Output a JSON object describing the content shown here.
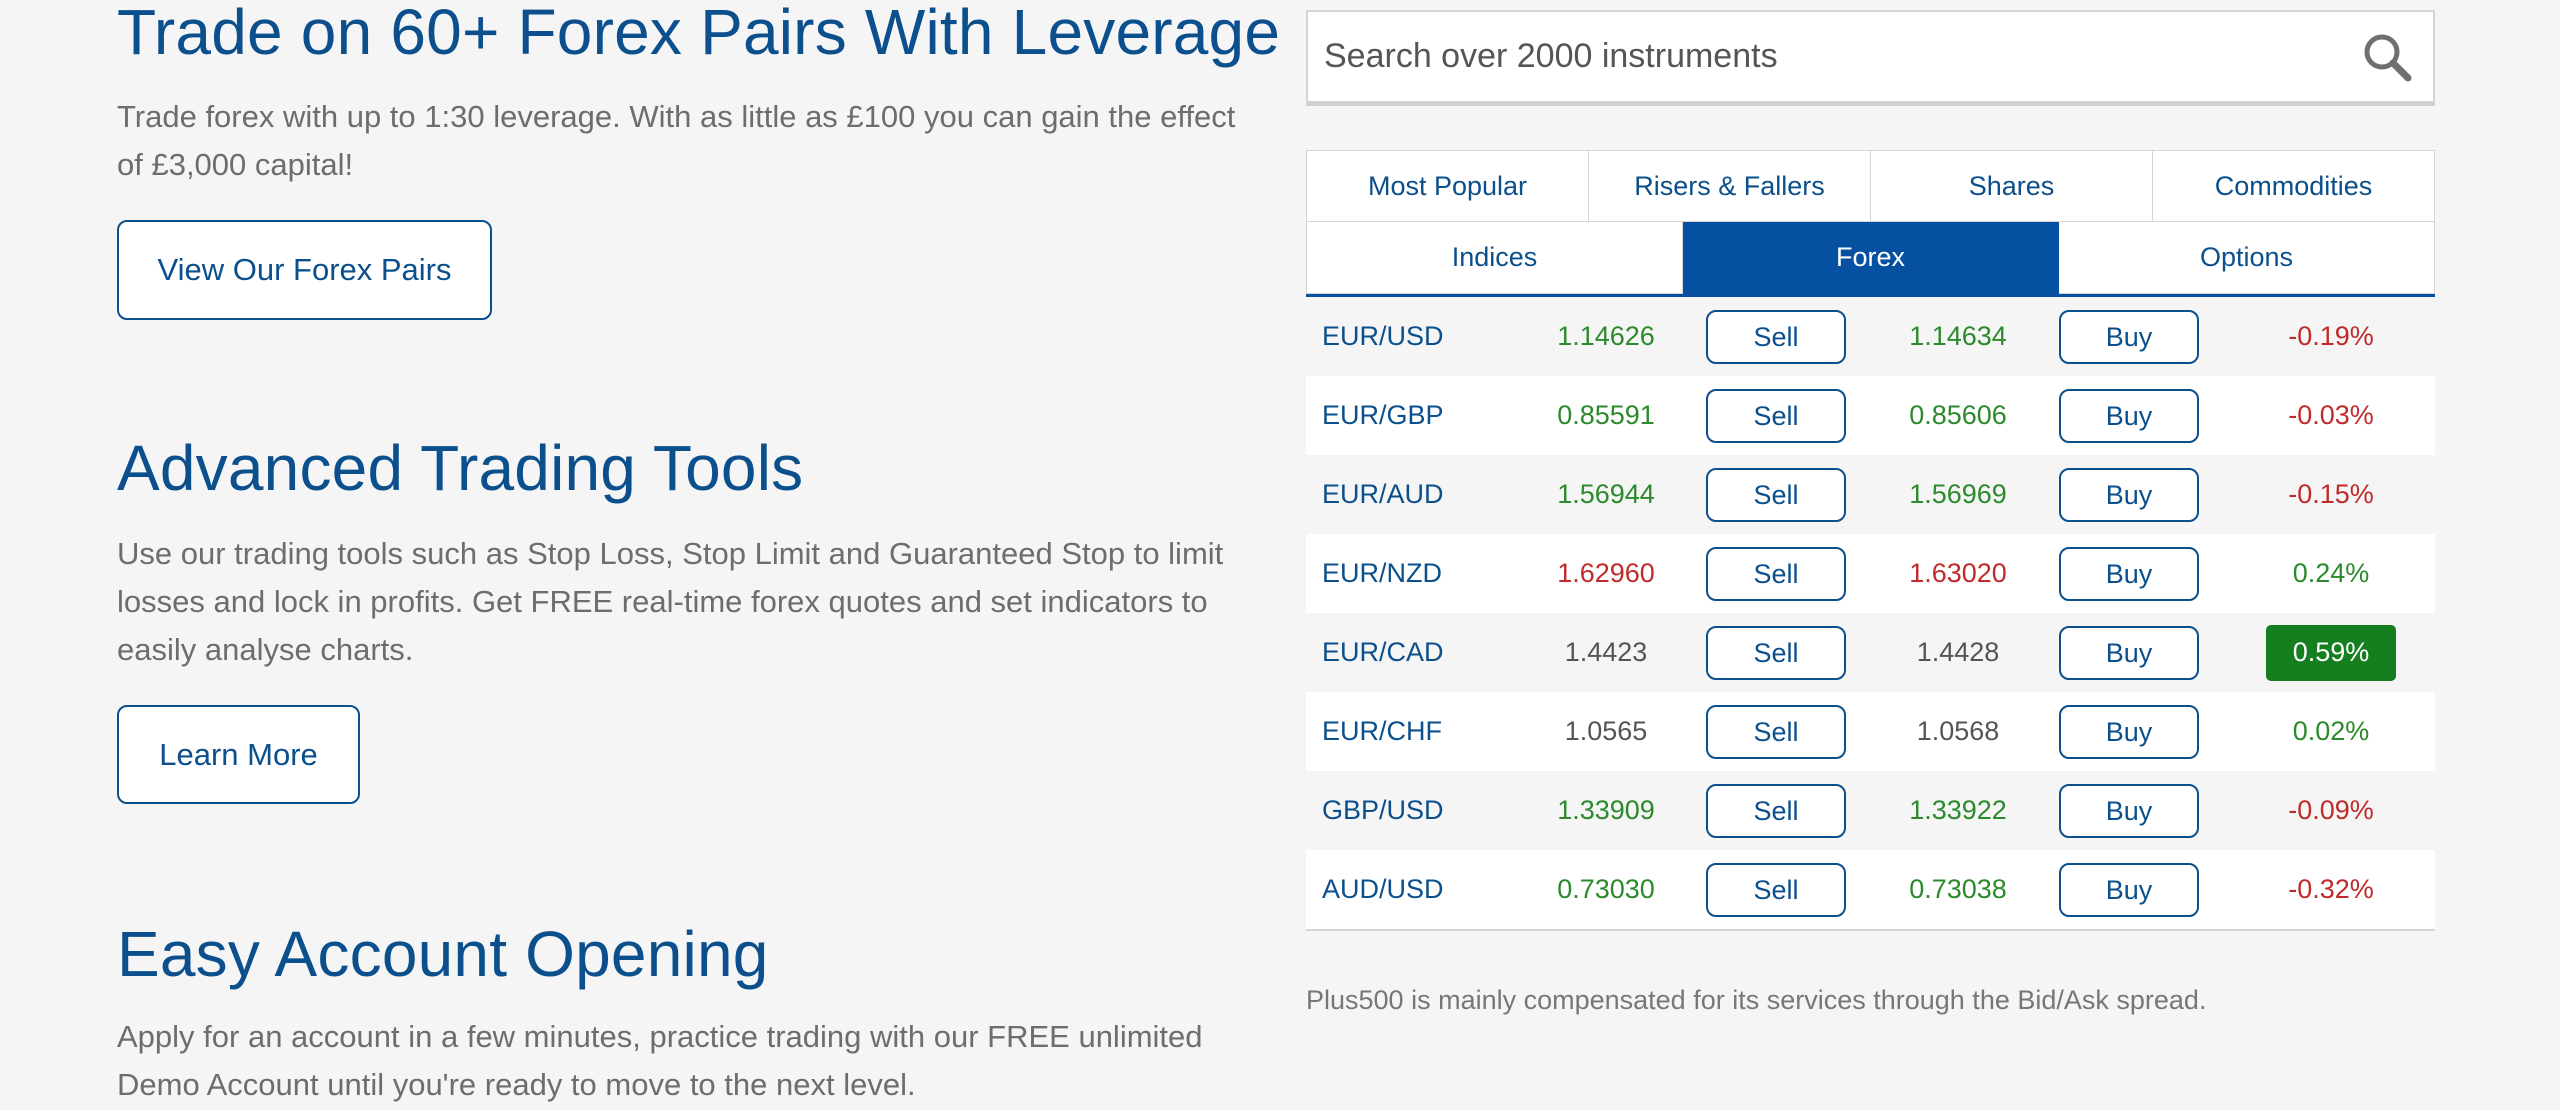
{
  "sections": [
    {
      "title": "Trade on 60+ Forex Pairs With Leverage",
      "body": "Trade forex with up to 1:30 leverage. With as little as £100 you can gain the effect of £3,000 capital!",
      "button": "View Our Forex Pairs"
    },
    {
      "title": "Advanced Trading Tools",
      "body": "Use our trading tools such as Stop Loss, Stop Limit and Guaranteed Stop to limit losses and lock in profits. Get FREE real-time forex quotes and set indicators to easily analyse charts.",
      "button": "Learn More"
    },
    {
      "title": "Easy Account Opening",
      "body": "Apply for an account in a few minutes, practice trading with our FREE unlimited Demo Account until you're ready to move to the next level."
    }
  ],
  "search": {
    "placeholder": "Search over 2000 instruments",
    "icon": "search-icon"
  },
  "tabs": {
    "row1": [
      "Most Popular",
      "Risers & Fallers",
      "Shares",
      "Commodities"
    ],
    "row2": [
      "Indices",
      "Forex",
      "Options"
    ],
    "active": "Forex"
  },
  "quotes": [
    {
      "pair": "EUR/USD",
      "sell": "1.14626",
      "buy": "1.14634",
      "change": "-0.19%",
      "price_trend": "up",
      "change_trend": "down",
      "highlight": false
    },
    {
      "pair": "EUR/GBP",
      "sell": "0.85591",
      "buy": "0.85606",
      "change": "-0.03%",
      "price_trend": "up",
      "change_trend": "down",
      "highlight": false
    },
    {
      "pair": "EUR/AUD",
      "sell": "1.56944",
      "buy": "1.56969",
      "change": "-0.15%",
      "price_trend": "up",
      "change_trend": "down",
      "highlight": false
    },
    {
      "pair": "EUR/NZD",
      "sell": "1.62960",
      "buy": "1.63020",
      "change": "0.24%",
      "price_trend": "down",
      "change_trend": "up",
      "highlight": false
    },
    {
      "pair": "EUR/CAD",
      "sell": "1.4423",
      "buy": "1.4428",
      "change": "0.59%",
      "price_trend": "flat",
      "change_trend": "up",
      "highlight": true
    },
    {
      "pair": "EUR/CHF",
      "sell": "1.0565",
      "buy": "1.0568",
      "change": "0.02%",
      "price_trend": "flat",
      "change_trend": "up",
      "highlight": false
    },
    {
      "pair": "GBP/USD",
      "sell": "1.33909",
      "buy": "1.33922",
      "change": "-0.09%",
      "price_trend": "up",
      "change_trend": "down",
      "highlight": false
    },
    {
      "pair": "AUD/USD",
      "sell": "0.73030",
      "buy": "0.73038",
      "change": "-0.32%",
      "price_trend": "up",
      "change_trend": "down",
      "highlight": false
    }
  ],
  "labels": {
    "sell_button": "Sell",
    "buy_button": "Buy"
  },
  "disclaimer": "Plus500 is mainly compensated for its services through the Bid/Ask spread.",
  "colors": {
    "brand_blue": "#0b4f8c",
    "active_tab": "#0550a0",
    "up": "#2b8a2b",
    "down": "#c02a2a",
    "highlight_bg": "#157f1f"
  }
}
